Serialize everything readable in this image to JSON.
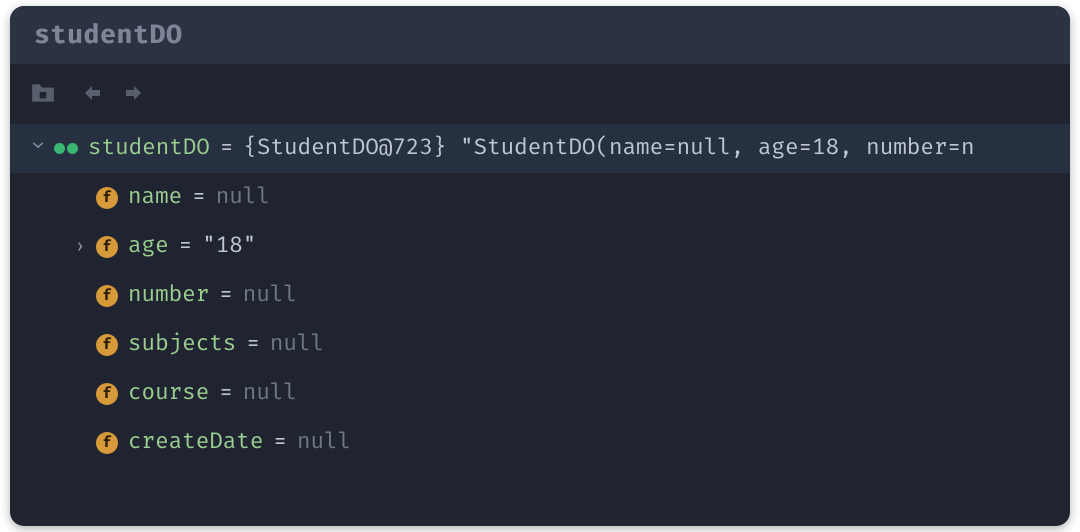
{
  "title": "studentDO",
  "root": {
    "name": "studentDO",
    "reference": "{StudentDO@723}",
    "tostring": "\"StudentDO(name=null, age=18, number=n",
    "equals": "="
  },
  "fields": [
    {
      "name": "name",
      "value": "null",
      "type": "null",
      "expandable": false
    },
    {
      "name": "age",
      "value": "\"18\"",
      "type": "string",
      "expandable": true
    },
    {
      "name": "number",
      "value": "null",
      "type": "null",
      "expandable": false
    },
    {
      "name": "subjects",
      "value": "null",
      "type": "null",
      "expandable": false
    },
    {
      "name": "course",
      "value": "null",
      "type": "null",
      "expandable": false
    },
    {
      "name": "createDate",
      "value": "null",
      "type": "null",
      "expandable": false
    }
  ],
  "icons": {
    "folder": "folder-close-icon",
    "back": "arrow-left-icon",
    "forward": "arrow-right-icon",
    "field": "f"
  }
}
